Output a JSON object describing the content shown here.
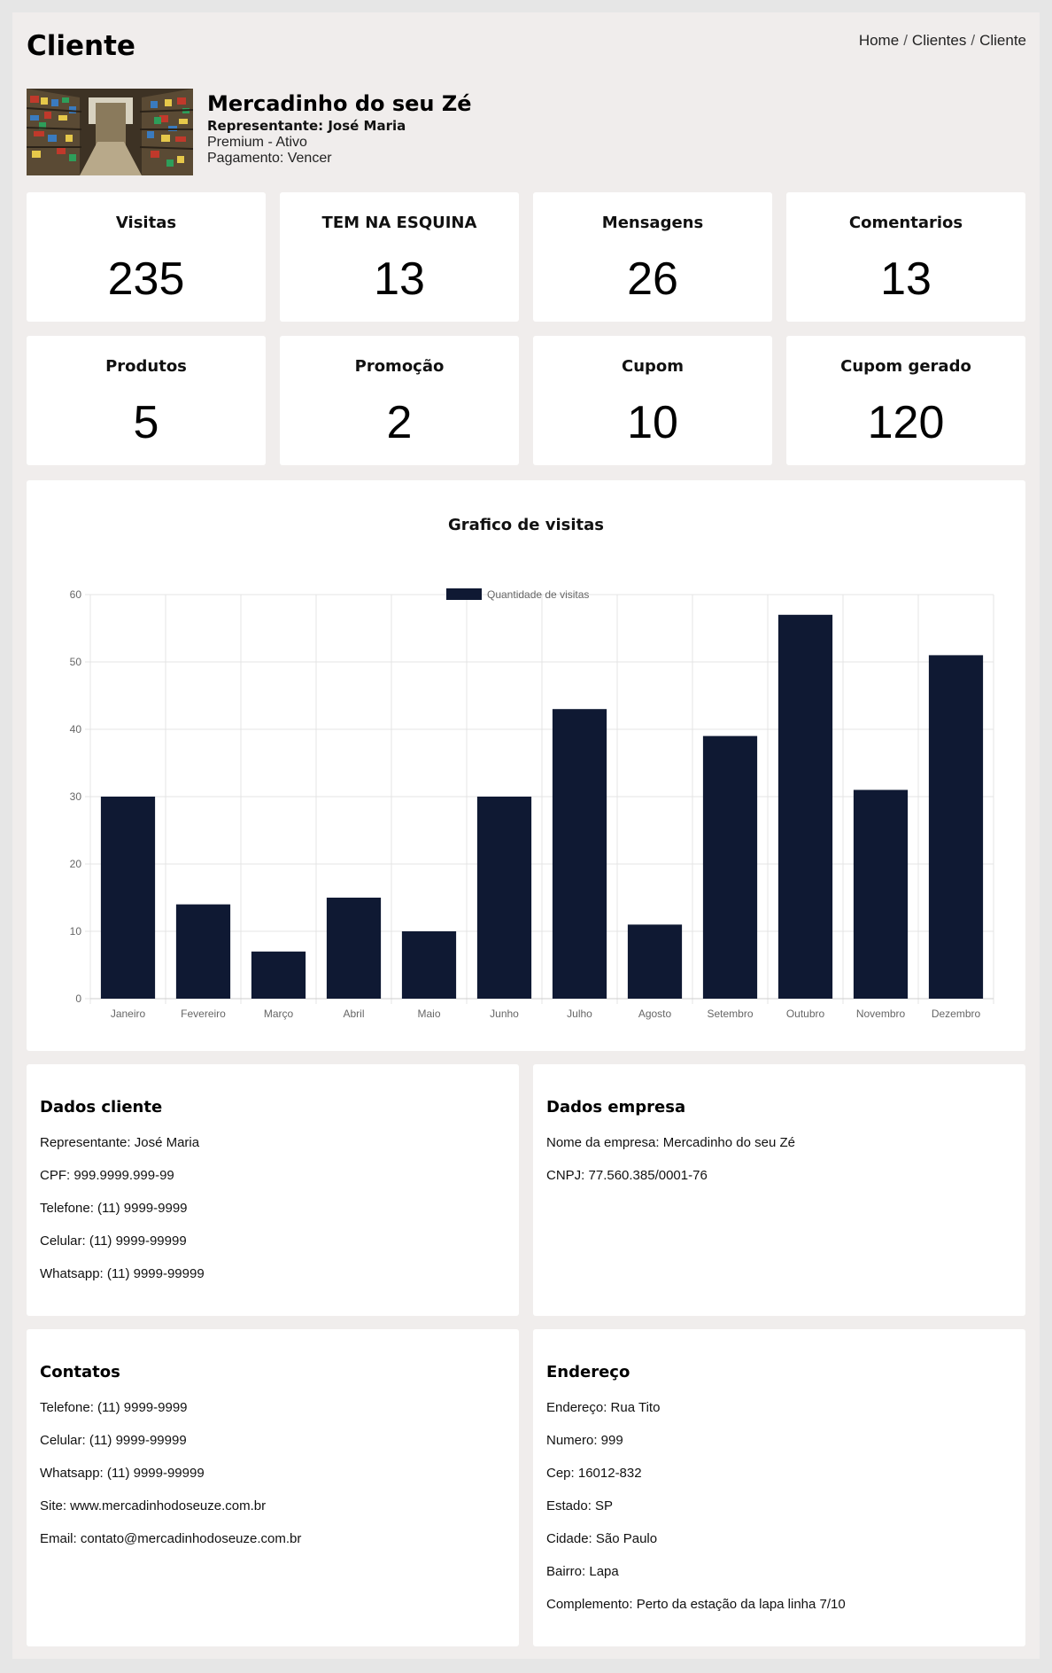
{
  "header": {
    "title": "Cliente",
    "breadcrumb": [
      "Home",
      "Clientes",
      "Cliente"
    ]
  },
  "profile": {
    "store_name": "Mercadinho do seu Zé",
    "representative": "Representante: José Maria",
    "plan": "Premium - Ativo",
    "payment": "Pagamento: Vencer"
  },
  "stats": [
    {
      "label": "Visitas",
      "value": "235"
    },
    {
      "label": "TEM NA ESQUINA",
      "value": "13"
    },
    {
      "label": "Mensagens",
      "value": "26"
    },
    {
      "label": "Comentarios",
      "value": "13"
    },
    {
      "label": "Produtos",
      "value": "5"
    },
    {
      "label": "Promoção",
      "value": "2"
    },
    {
      "label": "Cupom",
      "value": "10"
    },
    {
      "label": "Cupom gerado",
      "value": "120"
    }
  ],
  "chart_data": {
    "type": "bar",
    "title": "Grafico de visitas",
    "categories": [
      "Janeiro",
      "Fevereiro",
      "Março",
      "Abril",
      "Maio",
      "Junho",
      "Julho",
      "Agosto",
      "Setembro",
      "Outubro",
      "Novembro",
      "Dezembro"
    ],
    "series": [
      {
        "name": "Quantidade de visitas",
        "values": [
          30,
          14,
          7,
          15,
          10,
          30,
          43,
          11,
          39,
          57,
          31,
          51
        ],
        "color": "#0f1933"
      }
    ],
    "ylim": [
      0,
      60
    ],
    "yticks": [
      0,
      10,
      20,
      30,
      40,
      50,
      60
    ],
    "grid": true,
    "legend": "top"
  },
  "dados_cliente": {
    "title": "Dados cliente",
    "lines": [
      "Representante: José Maria",
      "CPF: 999.9999.999-99",
      "Telefone: (11) 9999-9999",
      "Celular: (11) 9999-99999",
      "Whatsapp: (11) 9999-99999"
    ]
  },
  "dados_empresa": {
    "title": "Dados empresa",
    "lines": [
      "Nome da empresa: Mercadinho do seu Zé",
      "CNPJ: 77.560.385/0001-76"
    ]
  },
  "contatos": {
    "title": "Contatos",
    "lines": [
      "Telefone: (11) 9999-9999",
      "Celular: (11) 9999-99999",
      "Whatsapp: (11) 9999-99999",
      "Site: www.mercadinhodoseuze.com.br",
      "Email: contato@mercadinhodoseuze.com.br"
    ]
  },
  "endereco": {
    "title": "Endereço",
    "lines": [
      "Endereço: Rua Tito",
      "Numero: 999",
      "Cep: 16012-832",
      "Estado: SP",
      "Cidade: São Paulo",
      "Bairro: Lapa",
      "Complemento: Perto da estação da lapa linha 7/10"
    ]
  }
}
